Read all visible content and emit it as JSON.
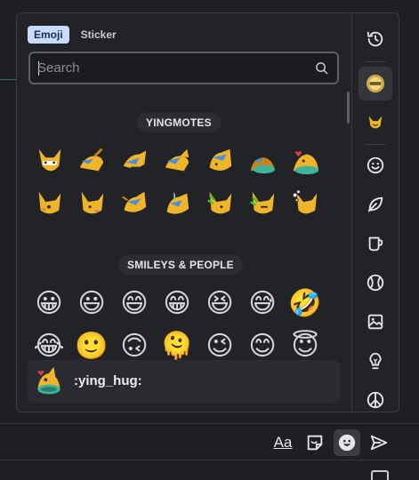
{
  "tabs": [
    {
      "label": "Emoji",
      "active": true
    },
    {
      "label": "Sticker",
      "active": false
    }
  ],
  "search": {
    "placeholder": "Search",
    "value": ""
  },
  "categories": [
    {
      "label": "YINGMOTES"
    },
    {
      "label": "SMILEYS & PEOPLE"
    }
  ],
  "smileys_row1": [
    "😀",
    "😃",
    "😄",
    "😁",
    "😆",
    "😅",
    "🤣"
  ],
  "smileys_row2": [
    "😂",
    "🙂",
    "🙃",
    "🫠",
    "😉",
    "😊",
    "😇"
  ],
  "preview": {
    "shortcode": ":ying_hug:"
  },
  "sidebar_items": [
    {
      "name": "recent-icon"
    },
    {
      "name": "custom-pack-badge-icon"
    },
    {
      "name": "custom-pack-ying-icon"
    },
    {
      "name": "smiley-icon"
    },
    {
      "name": "leaf-icon"
    },
    {
      "name": "cup-icon"
    },
    {
      "name": "ball-icon"
    },
    {
      "name": "image-icon"
    },
    {
      "name": "lightbulb-icon"
    },
    {
      "name": "peace-icon"
    }
  ],
  "composer": {
    "format_label": "Aa"
  },
  "colors": {
    "accent": "#c8dcff",
    "panel": "#222327",
    "background": "#1e1f23"
  }
}
